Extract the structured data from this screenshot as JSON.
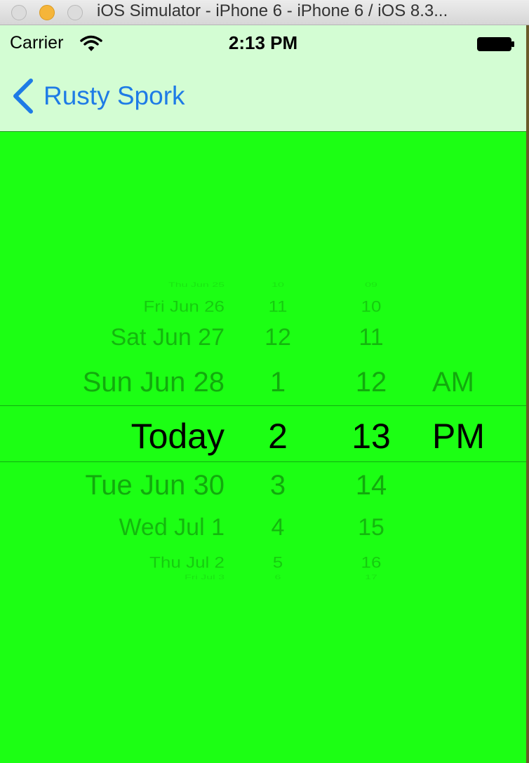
{
  "window": {
    "title": "iOS Simulator - iPhone 6 - iPhone 6 / iOS 8.3..."
  },
  "status_bar": {
    "carrier": "Carrier",
    "time": "2:13 PM"
  },
  "nav": {
    "back_label": "Rusty Spork"
  },
  "picker": {
    "dates": [
      "Thu Jun 25",
      "Fri Jun 26",
      "Sat Jun 27",
      "Sun Jun 28",
      "Today",
      "Tue Jun 30",
      "Wed Jul 1",
      "Thu Jul 2",
      "Fri Jul 3"
    ],
    "hours": [
      "10",
      "11",
      "12",
      "1",
      "2",
      "3",
      "4",
      "5",
      "6"
    ],
    "minutes": [
      "09",
      "10",
      "11",
      "12",
      "13",
      "14",
      "15",
      "16",
      "17"
    ],
    "ampm": [
      "AM",
      "PM"
    ],
    "selected": {
      "date": "Today",
      "hour": "2",
      "minute": "13",
      "ampm": "PM"
    }
  },
  "colors": {
    "background": "#1cff14",
    "bar": "#d3fdd3",
    "tint": "#1e7be6"
  }
}
